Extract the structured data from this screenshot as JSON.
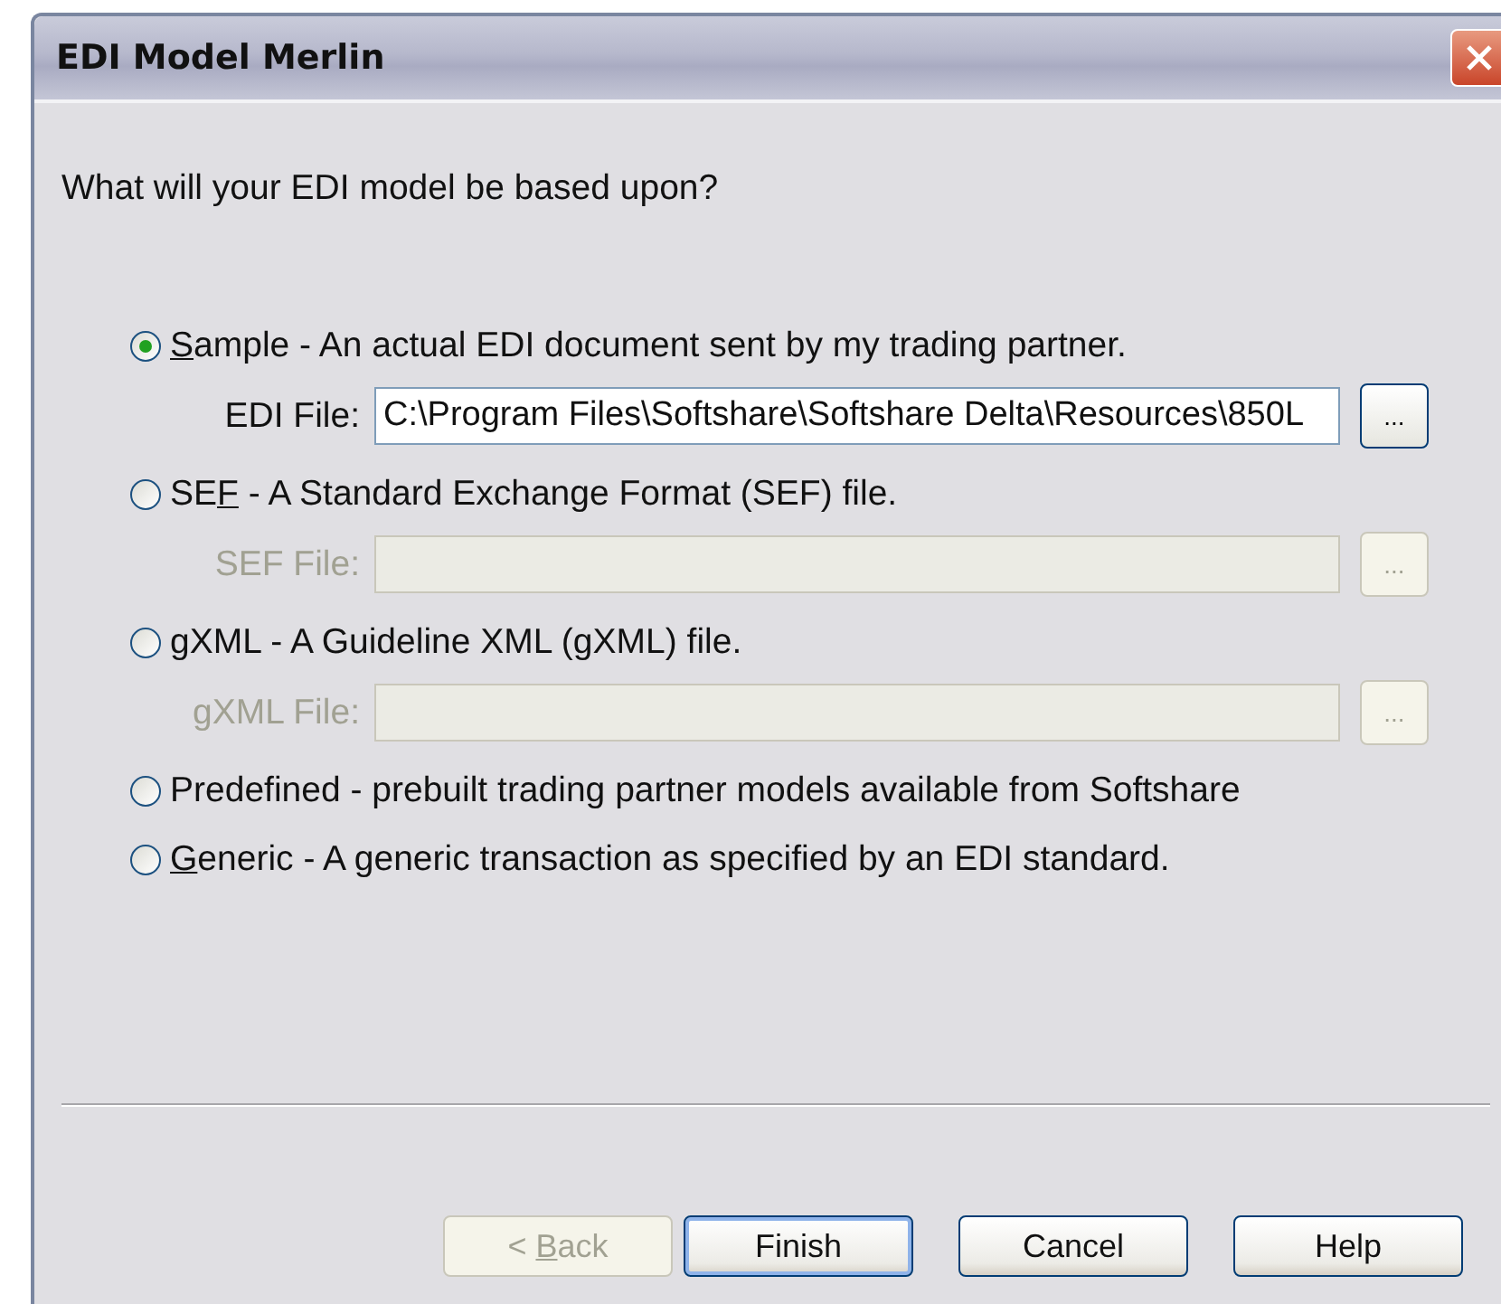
{
  "window": {
    "title": "EDI Model Merlin"
  },
  "question": "What will your EDI model be based upon?",
  "options": [
    {
      "kind": "file",
      "selected": true,
      "label": {
        "key": "S",
        "after": "ample - An actual EDI document sent by my trading partner."
      },
      "file": {
        "label": {
          "before": "EDI File:"
        },
        "value": "C:\\Program Files\\Softshare\\Softshare Delta\\Resources\\850L",
        "disabled": false,
        "browse": "..."
      }
    },
    {
      "kind": "file",
      "selected": false,
      "label": {
        "before": "SE",
        "key": "F",
        "after": " - A Standard Exchange Format (SEF) file."
      },
      "file": {
        "label": {
          "before": "SEF File:"
        },
        "disabled": true,
        "browse": "..."
      }
    },
    {
      "kind": "file",
      "selected": false,
      "label": {
        "key": "g",
        "after": "XML - A Guideline XML (gXML) file."
      },
      "file": {
        "label": {
          "key": "g",
          "after": "XML File:"
        },
        "disabled": true,
        "browse": "..."
      }
    },
    {
      "kind": "plain",
      "selected": false,
      "label": {
        "before": "Predefined - prebuilt trading partner models available from Softshare"
      }
    },
    {
      "kind": "plain",
      "selected": false,
      "label": {
        "key": "G",
        "after": "eneric - A generic transaction as specified by an EDI standard."
      }
    }
  ],
  "buttons": [
    {
      "label": {
        "before": "< ",
        "key": "B",
        "after": "ack"
      },
      "disabled": true,
      "default": false
    },
    {
      "label": {
        "before": "Finish"
      },
      "disabled": false,
      "default": true
    },
    {
      "label": {
        "before": "Cancel"
      },
      "disabled": false,
      "default": false
    },
    {
      "label": {
        "before": "Help"
      },
      "disabled": false,
      "default": false
    }
  ]
}
